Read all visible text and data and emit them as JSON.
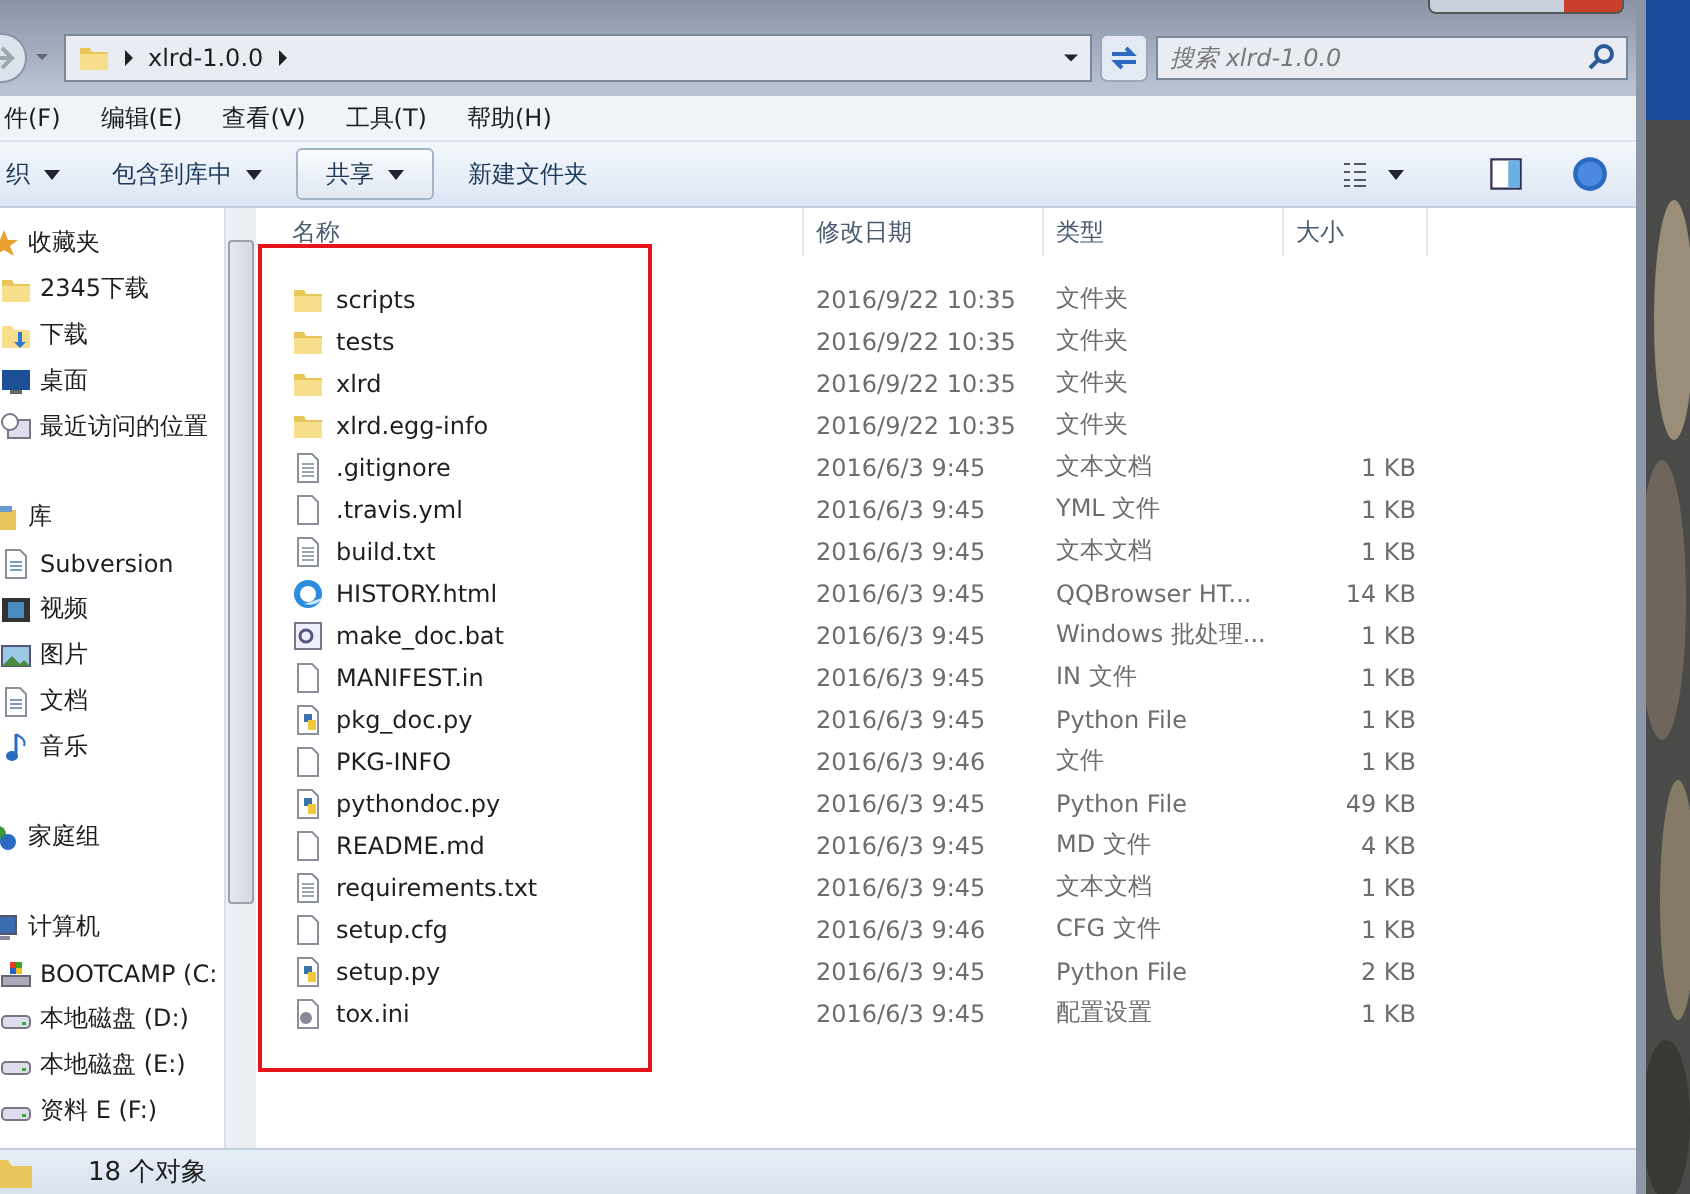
{
  "address_bar": {
    "crumbs": [
      "xlrd-1.0.0"
    ],
    "search_placeholder": "搜索 xlrd-1.0.0"
  },
  "menu": [
    "件(F)",
    "编辑(E)",
    "查看(V)",
    "工具(T)",
    "帮助(H)"
  ],
  "toolbar": [
    {
      "label": "织",
      "dropdown": true,
      "kind": "plain"
    },
    {
      "label": "包含到库中",
      "dropdown": true,
      "kind": "plain"
    },
    {
      "label": "共享",
      "dropdown": true,
      "kind": "boxed"
    },
    {
      "label": "新建文件夹",
      "dropdown": false,
      "kind": "plain"
    }
  ],
  "sidebar": [
    {
      "label": "收藏夹",
      "kind": "star",
      "children": [
        {
          "label": "2345下载",
          "kind": "folder"
        },
        {
          "label": "下载",
          "kind": "download"
        },
        {
          "label": "桌面",
          "kind": "desktop"
        },
        {
          "label": "最近访问的位置",
          "kind": "recent"
        }
      ]
    },
    {
      "label": "库",
      "kind": "library",
      "children": [
        {
          "label": "Subversion",
          "kind": "document"
        },
        {
          "label": "视频",
          "kind": "video"
        },
        {
          "label": "图片"
        },
        {
          "label": "文档",
          "kind": "document"
        },
        {
          "label": "音乐",
          "kind": "music"
        }
      ]
    },
    {
      "label": "家庭组",
      "kind": "homegroup"
    },
    {
      "label": "计算机",
      "kind": "computer",
      "children": [
        {
          "label": "BOOTCAMP (C:",
          "kind": "system-drive"
        },
        {
          "label": "本地磁盘 (D:)",
          "kind": "drive"
        },
        {
          "label": "本地磁盘 (E:)",
          "kind": "drive"
        },
        {
          "label": "资料 E (F:)",
          "kind": "drive"
        }
      ]
    }
  ],
  "columns": [
    "名称",
    "修改日期",
    "类型",
    "大小"
  ],
  "files": [
    {
      "name": "scripts",
      "date": "2016/9/22 10:35",
      "type": "文件夹",
      "kind": "folder"
    },
    {
      "name": "tests",
      "date": "2016/9/22 10:35",
      "type": "文件夹",
      "kind": "folder"
    },
    {
      "name": "xlrd",
      "date": "2016/9/22 10:35",
      "type": "文件夹",
      "kind": "folder"
    },
    {
      "name": "xlrd.egg-info",
      "date": "2016/9/22 10:35",
      "type": "文件夹",
      "kind": "folder"
    },
    {
      "name": ".gitignore",
      "date": "2016/6/3 9:45",
      "type": "文本文档",
      "size": "1 KB",
      "kind": "text"
    },
    {
      "name": ".travis.yml",
      "date": "2016/6/3 9:45",
      "type": "YML 文件",
      "size": "1 KB",
      "kind": "blank"
    },
    {
      "name": "build.txt",
      "date": "2016/6/3 9:45",
      "type": "文本文档",
      "size": "1 KB",
      "kind": "text"
    },
    {
      "name": "HISTORY.html",
      "date": "2016/6/3 9:45",
      "type": "QQBrowser HT...",
      "size": "14 KB",
      "kind": "browser"
    },
    {
      "name": "make_doc.bat",
      "date": "2016/6/3 9:45",
      "type": "Windows 批处理...",
      "size": "1 KB",
      "kind": "batch"
    },
    {
      "name": "MANIFEST.in",
      "date": "2016/6/3 9:45",
      "type": "IN 文件",
      "size": "1 KB",
      "kind": "blank"
    },
    {
      "name": "pkg_doc.py",
      "date": "2016/6/3 9:45",
      "type": "Python File",
      "size": "1 KB",
      "kind": "python"
    },
    {
      "name": "PKG-INFO",
      "date": "2016/6/3 9:46",
      "type": "文件",
      "size": "1 KB",
      "kind": "blank"
    },
    {
      "name": "pythondoc.py",
      "date": "2016/6/3 9:45",
      "type": "Python File",
      "size": "49 KB",
      "kind": "python"
    },
    {
      "name": "README.md",
      "date": "2016/6/3 9:45",
      "type": "MD 文件",
      "size": "4 KB",
      "kind": "blank"
    },
    {
      "name": "requirements.txt",
      "date": "2016/6/3 9:45",
      "type": "文本文档",
      "size": "1 KB",
      "kind": "text"
    },
    {
      "name": "setup.cfg",
      "date": "2016/6/3 9:46",
      "type": "CFG 文件",
      "size": "1 KB",
      "kind": "blank"
    },
    {
      "name": "setup.py",
      "date": "2016/6/3 9:45",
      "type": "Python File",
      "size": "2 KB",
      "kind": "python"
    },
    {
      "name": "tox.ini",
      "date": "2016/6/3 9:45",
      "type": "配置设置",
      "size": "1 KB",
      "kind": "config"
    }
  ],
  "status_bar": {
    "count": "18 个对象"
  }
}
